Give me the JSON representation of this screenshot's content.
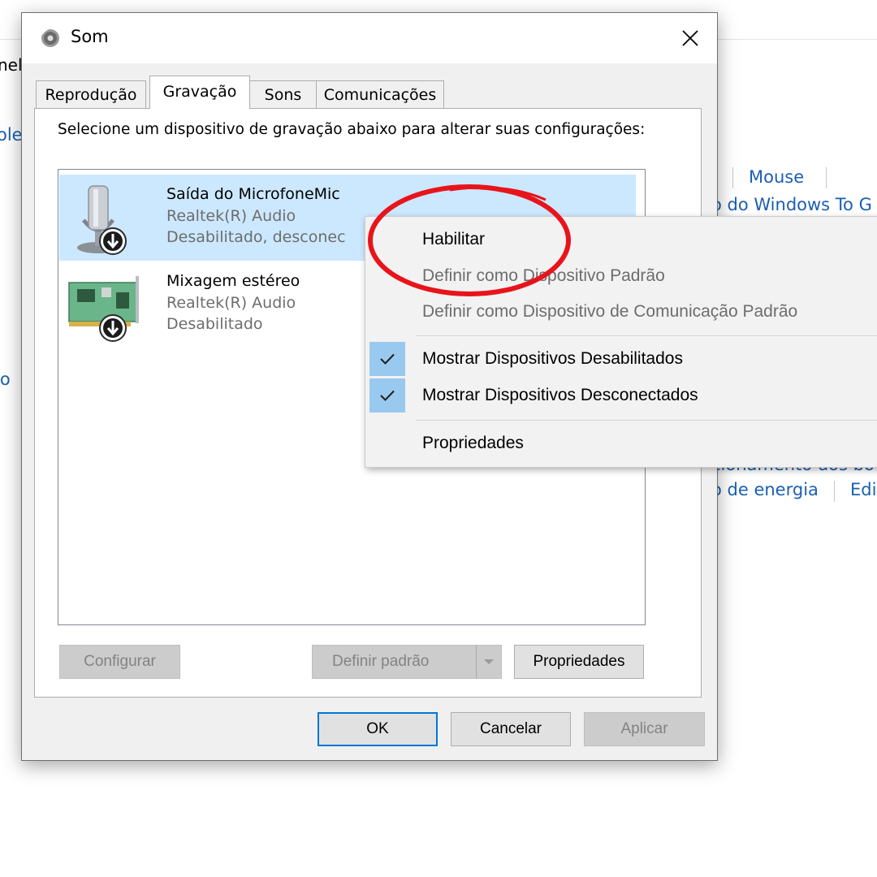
{
  "background": {
    "cut_left_1": "nel",
    "cut_left_2": "ole",
    "cut_left_3": "io",
    "link_mouse": "Mouse",
    "link_windows_to_go": "o do Windows To G",
    "link_row2_partial": "cionamento dos bo",
    "link_energia": "o de energia",
    "link_edi": "Edi"
  },
  "dialog": {
    "title": "Som",
    "tabs": [
      {
        "label": "Reprodução",
        "active": false
      },
      {
        "label": "Gravação",
        "active": true
      },
      {
        "label": "Sons",
        "active": false
      },
      {
        "label": "Comunicações",
        "active": false
      }
    ],
    "instruction": "Selecione um dispositivo de gravação abaixo para alterar suas configurações:",
    "devices": [
      {
        "name": "Saída do MicrofoneMic",
        "driver": "Realtek(R) Audio",
        "status": "Desabilitado, desconec",
        "selected": true
      },
      {
        "name": "Mixagem estéreo",
        "driver": "Realtek(R) Audio",
        "status": "Desabilitado",
        "selected": false
      }
    ],
    "buttons": {
      "configure": "Configurar",
      "set_default": "Definir padrão",
      "properties": "Propriedades",
      "ok": "OK",
      "cancel": "Cancelar",
      "apply": "Aplicar"
    }
  },
  "context_menu": {
    "items": [
      {
        "label": "Habilitar",
        "enabled": true,
        "checked": false
      },
      {
        "label": "Definir como Dispositivo Padrão",
        "enabled": false,
        "checked": false
      },
      {
        "label": "Definir como Dispositivo de Comunicação Padrão",
        "enabled": false,
        "checked": false
      },
      {
        "label": "Mostrar Dispositivos Desabilitados",
        "enabled": true,
        "checked": true
      },
      {
        "label": "Mostrar Dispositivos Desconectados",
        "enabled": true,
        "checked": true
      },
      {
        "label": "Propriedades",
        "enabled": true,
        "checked": false
      }
    ]
  },
  "annotation": {
    "color": "#e8141b",
    "shape": "ellipse",
    "target": "Habilitar"
  },
  "colors": {
    "selection": "#cce8ff",
    "accent": "#0078d7",
    "link": "#1a5fb4",
    "check_highlight": "#99c9ef"
  }
}
